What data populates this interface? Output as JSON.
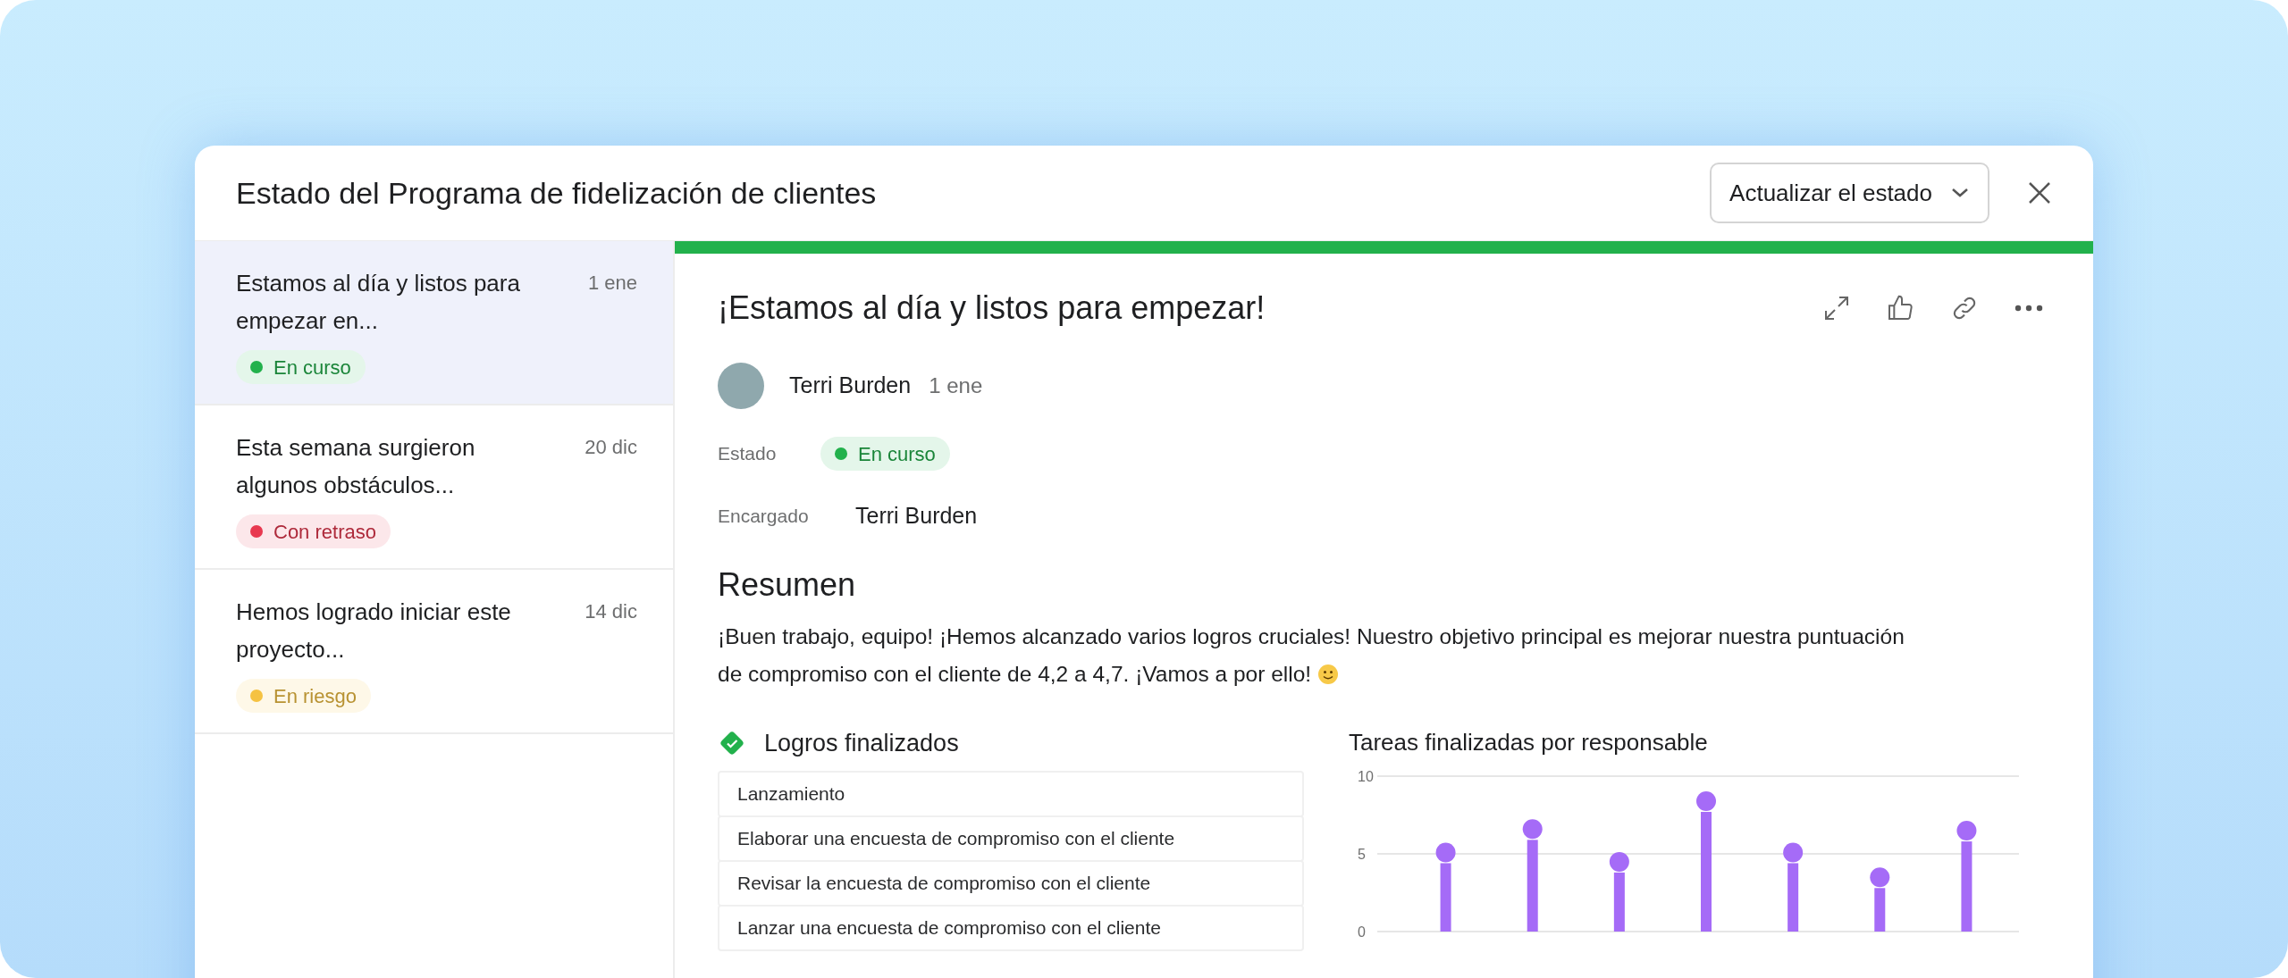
{
  "dialog": {
    "title": "Estado del Programa de fidelización de clientes",
    "update_button": "Actualizar el estado"
  },
  "updates": [
    {
      "title": "Estamos al día y listos para empezar en...",
      "date": "1 ene",
      "status": {
        "label": "En curso",
        "color": "#22b14c"
      },
      "selected": true
    },
    {
      "title": "Esta semana surgieron algunos obstáculos...",
      "date": "20 dic",
      "status": {
        "label": "Con retraso",
        "color": "#e8384f"
      },
      "selected": false
    },
    {
      "title": "Hemos logrado iniciar este proyecto...",
      "date": "14 dic",
      "status": {
        "label": "En riesgo",
        "color": "#f5c242"
      },
      "selected": false
    }
  ],
  "detail": {
    "title": "¡Estamos al día y listos para empezar!",
    "author": {
      "name": "Terri Burden",
      "date": "1 ene"
    },
    "fields": [
      {
        "label": "Estado",
        "kind": "status",
        "value": "En curso",
        "color": "#22b14c"
      },
      {
        "label": "Encargado",
        "kind": "text",
        "value": "Terri Burden"
      }
    ],
    "summary": {
      "heading": "Resumen",
      "text": "¡Buen trabajo, equipo! ¡Hemos alcanzado varios logros cruciales! Nuestro objetivo principal es mejorar nuestra puntuación de compromiso con el cliente de 4,2 a 4,7.  ¡Vamos a por ello!"
    },
    "achievements": {
      "heading": "Logros finalizados",
      "items": [
        "Lanzamiento",
        "Elaborar una encuesta de compromiso con el cliente",
        "Revisar la encuesta de compromiso con el cliente",
        "Lanzar una encuesta de compromiso con el cliente"
      ]
    },
    "chart": {
      "title": "Tareas finalizadas por responsable",
      "chart_data": {
        "type": "bar",
        "ylim": [
          0,
          10
        ],
        "yticks": [
          0,
          5,
          10
        ],
        "series": [
          {
            "color": "#a56bf7",
            "values": [
              4.4,
              5.9,
              3.8,
              7.7,
              4.4,
              2.8,
              5.8
            ]
          }
        ]
      }
    }
  }
}
